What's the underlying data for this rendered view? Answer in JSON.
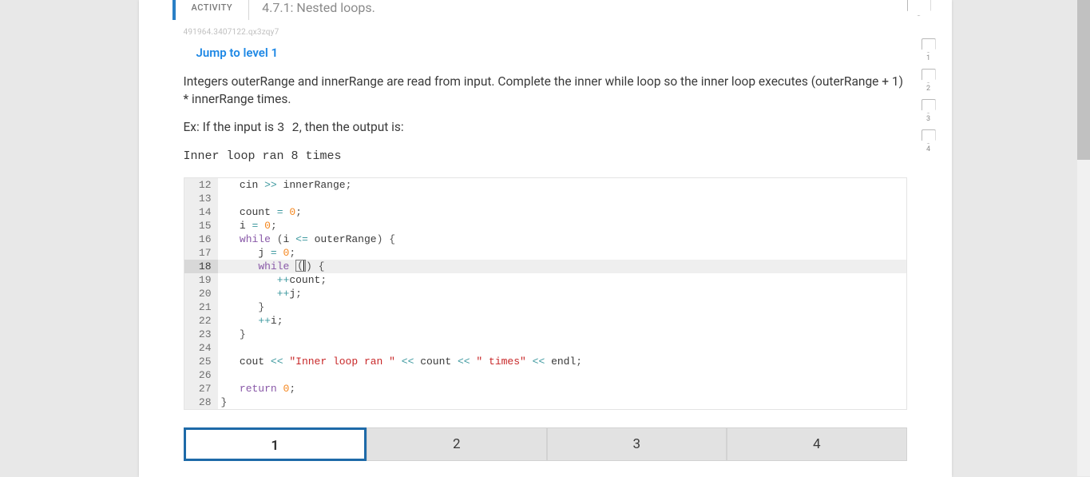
{
  "activity": {
    "label": "ACTIVITY",
    "title": "4.7.1: Nested loops."
  },
  "hash_id": "491964.3407122.qx3zqy7",
  "jump_link": "Jump to level 1",
  "prompt": "Integers outerRange and innerRange are read from input. Complete the inner while loop so the inner loop executes (outerRange + 1) * innerRange times.",
  "example": {
    "prefix": "Ex: If the input is ",
    "input_val": "3  2",
    "suffix": ", then the output is:"
  },
  "output_sample": "Inner loop ran 8 times",
  "levels": [
    {
      "num": "1"
    },
    {
      "num": "2"
    },
    {
      "num": "3"
    },
    {
      "num": "4"
    }
  ],
  "code_lines": [
    {
      "n": "12",
      "active": false,
      "tokens": [
        {
          "t": "   ",
          "c": ""
        },
        {
          "t": "cin",
          "c": "ident"
        },
        {
          "t": " ",
          "c": ""
        },
        {
          "t": ">>",
          "c": "op"
        },
        {
          "t": " innerRange",
          "c": "ident"
        },
        {
          "t": ";",
          "c": "punct"
        }
      ]
    },
    {
      "n": "13",
      "active": false,
      "tokens": []
    },
    {
      "n": "14",
      "active": false,
      "tokens": [
        {
          "t": "   count ",
          "c": "ident"
        },
        {
          "t": "=",
          "c": "op"
        },
        {
          "t": " ",
          "c": ""
        },
        {
          "t": "0",
          "c": "num"
        },
        {
          "t": ";",
          "c": "punct"
        }
      ]
    },
    {
      "n": "15",
      "active": false,
      "tokens": [
        {
          "t": "   i ",
          "c": "ident"
        },
        {
          "t": "=",
          "c": "op"
        },
        {
          "t": " ",
          "c": ""
        },
        {
          "t": "0",
          "c": "num"
        },
        {
          "t": ";",
          "c": "punct"
        }
      ]
    },
    {
      "n": "16",
      "active": false,
      "tokens": [
        {
          "t": "   ",
          "c": ""
        },
        {
          "t": "while",
          "c": "kw"
        },
        {
          "t": " ",
          "c": ""
        },
        {
          "t": "(",
          "c": "punct"
        },
        {
          "t": "i ",
          "c": "ident"
        },
        {
          "t": "<=",
          "c": "op"
        },
        {
          "t": " outerRange",
          "c": "ident"
        },
        {
          "t": ")",
          "c": "punct"
        },
        {
          "t": " ",
          "c": ""
        },
        {
          "t": "{",
          "c": "punct"
        }
      ]
    },
    {
      "n": "17",
      "active": false,
      "tokens": [
        {
          "t": "      j ",
          "c": "ident"
        },
        {
          "t": "=",
          "c": "op"
        },
        {
          "t": " ",
          "c": ""
        },
        {
          "t": "0",
          "c": "num"
        },
        {
          "t": ";",
          "c": "punct"
        }
      ]
    },
    {
      "n": "18",
      "active": true,
      "tokens": [
        {
          "t": "      ",
          "c": ""
        },
        {
          "t": "while",
          "c": "kw"
        },
        {
          "t": " ",
          "c": ""
        },
        {
          "t": "(",
          "c": "punct",
          "boxed": true
        },
        {
          "t": ")",
          "c": "punct"
        },
        {
          "t": " ",
          "c": ""
        },
        {
          "t": "{",
          "c": "punct"
        }
      ]
    },
    {
      "n": "19",
      "active": false,
      "tokens": [
        {
          "t": "         ",
          "c": ""
        },
        {
          "t": "++",
          "c": "op"
        },
        {
          "t": "count",
          "c": "ident"
        },
        {
          "t": ";",
          "c": "punct"
        }
      ]
    },
    {
      "n": "20",
      "active": false,
      "tokens": [
        {
          "t": "         ",
          "c": ""
        },
        {
          "t": "++",
          "c": "op"
        },
        {
          "t": "j",
          "c": "ident"
        },
        {
          "t": ";",
          "c": "punct"
        }
      ]
    },
    {
      "n": "21",
      "active": false,
      "tokens": [
        {
          "t": "      ",
          "c": ""
        },
        {
          "t": "}",
          "c": "punct"
        }
      ]
    },
    {
      "n": "22",
      "active": false,
      "tokens": [
        {
          "t": "      ",
          "c": ""
        },
        {
          "t": "++",
          "c": "op"
        },
        {
          "t": "i",
          "c": "ident"
        },
        {
          "t": ";",
          "c": "punct"
        }
      ]
    },
    {
      "n": "23",
      "active": false,
      "tokens": [
        {
          "t": "   ",
          "c": ""
        },
        {
          "t": "}",
          "c": "punct"
        }
      ]
    },
    {
      "n": "24",
      "active": false,
      "tokens": []
    },
    {
      "n": "25",
      "active": false,
      "tokens": [
        {
          "t": "   cout ",
          "c": "ident"
        },
        {
          "t": "<<",
          "c": "op"
        },
        {
          "t": " ",
          "c": ""
        },
        {
          "t": "\"Inner loop ran \"",
          "c": "str"
        },
        {
          "t": " ",
          "c": ""
        },
        {
          "t": "<<",
          "c": "op"
        },
        {
          "t": " count ",
          "c": "ident"
        },
        {
          "t": "<<",
          "c": "op"
        },
        {
          "t": " ",
          "c": ""
        },
        {
          "t": "\" times\"",
          "c": "str"
        },
        {
          "t": " ",
          "c": ""
        },
        {
          "t": "<<",
          "c": "op"
        },
        {
          "t": " endl",
          "c": "ident"
        },
        {
          "t": ";",
          "c": "punct"
        }
      ]
    },
    {
      "n": "26",
      "active": false,
      "tokens": []
    },
    {
      "n": "27",
      "active": false,
      "tokens": [
        {
          "t": "   ",
          "c": ""
        },
        {
          "t": "return",
          "c": "kw"
        },
        {
          "t": " ",
          "c": ""
        },
        {
          "t": "0",
          "c": "num"
        },
        {
          "t": ";",
          "c": "punct"
        }
      ]
    },
    {
      "n": "28",
      "active": false,
      "tokens": [
        {
          "t": "}",
          "c": "punct"
        }
      ]
    }
  ],
  "tabs": [
    {
      "label": "1",
      "active": true
    },
    {
      "label": "2",
      "active": false
    },
    {
      "label": "3",
      "active": false
    },
    {
      "label": "4",
      "active": false
    }
  ]
}
